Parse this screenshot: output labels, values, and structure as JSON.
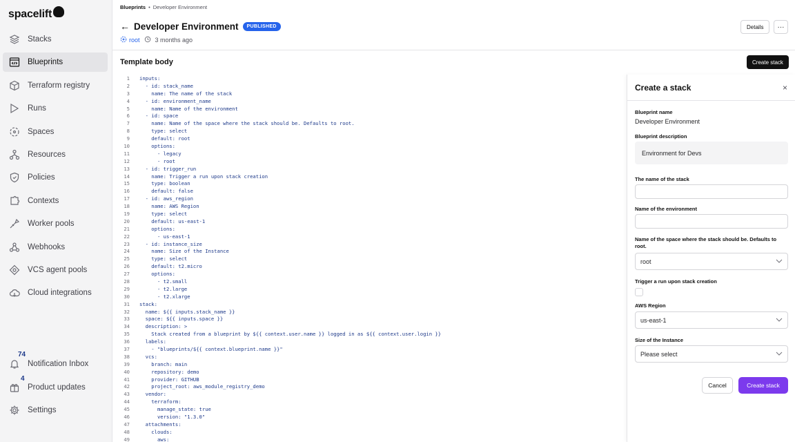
{
  "app": {
    "logo_text": "spacelift"
  },
  "sidebar": {
    "items": [
      {
        "label": "Stacks",
        "icon": "stacks-icon"
      },
      {
        "label": "Blueprints",
        "icon": "blueprints-icon"
      },
      {
        "label": "Terraform registry",
        "icon": "registry-icon"
      },
      {
        "label": "Runs",
        "icon": "runs-icon"
      },
      {
        "label": "Spaces",
        "icon": "spaces-icon"
      },
      {
        "label": "Resources",
        "icon": "resources-icon"
      },
      {
        "label": "Policies",
        "icon": "policies-icon"
      },
      {
        "label": "Contexts",
        "icon": "contexts-icon"
      },
      {
        "label": "Worker pools",
        "icon": "worker-pools-icon"
      },
      {
        "label": "Webhooks",
        "icon": "webhooks-icon"
      },
      {
        "label": "VCS agent pools",
        "icon": "vcs-agent-pools-icon"
      },
      {
        "label": "Cloud integrations",
        "icon": "cloud-integrations-icon"
      }
    ],
    "bottom": {
      "notifications": {
        "label": "Notification Inbox",
        "count": "74"
      },
      "updates": {
        "label": "Product updates",
        "count": "4"
      },
      "settings": {
        "label": "Settings"
      }
    }
  },
  "header": {
    "breadcrumb": {
      "parent": "Blueprints",
      "separator": "•",
      "current": "Developer Environment"
    },
    "title": "Developer Environment",
    "status": "PUBLISHED",
    "space": "root",
    "updated": "3 months ago",
    "details_label": "Details",
    "more_label": "···"
  },
  "template": {
    "section_title": "Template body",
    "create_button": "Create stack",
    "lines": [
      "inputs:",
      "  - id: stack_name",
      "    name: The name of the stack",
      "  - id: environment_name",
      "    name: Name of the environment",
      "  - id: space",
      "    name: Name of the space where the stack should be. Defaults to root.",
      "    type: select",
      "    default: root",
      "    options:",
      "      - legacy",
      "      - root",
      "  - id: trigger_run",
      "    name: Trigger a run upon stack creation",
      "    type: boolean",
      "    default: false",
      "  - id: aws_region",
      "    name: AWS Region",
      "    type: select",
      "    default: us-east-1",
      "    options:",
      "      - us-east-1",
      "  - id: instance_size",
      "    name: Size of the Instance",
      "    type: select",
      "    default: t2.micro",
      "    options:",
      "      - t2.small",
      "      - t2.large",
      "      - t2.xlarge",
      "stack:",
      "  name: ${{ inputs.stack_name }}",
      "  space: ${{ inputs.space }}",
      "  description: >",
      "    Stack created from a blueprint by ${{ context.user.name }} logged in as ${{ context.user.login }}",
      "  labels:",
      "    - \"blueprints/${{ context.blueprint.name }}\"",
      "  vcs:",
      "    branch: main",
      "    repository: demo",
      "    provider: GITHUB",
      "    project_root: aws_module_registry_demo",
      "  vendor:",
      "    terraform:",
      "      manage_state: true",
      "      version: \"1.3.0\"",
      "  attachments:",
      "    clouds:",
      "      aws:"
    ]
  },
  "drawer": {
    "title": "Create a stack",
    "close_label": "×",
    "blueprint_name_label": "Blueprint name",
    "blueprint_name_value": "Developer Environment",
    "blueprint_description_label": "Blueprint description",
    "blueprint_description_value": "Environment for Devs",
    "fields": {
      "stack_name_label": "The name of the stack",
      "stack_name_value": "",
      "environment_label": "Name of the environment",
      "environment_value": "",
      "space_label": "Name of the space where the stack should be. Defaults to root.",
      "space_value": "root",
      "trigger_label": "Trigger a run upon stack creation",
      "trigger_checked": false,
      "region_label": "AWS Region",
      "region_value": "us-east-1",
      "instance_label": "Size of the Instance",
      "instance_value": "Please select"
    },
    "cancel_label": "Cancel",
    "submit_label": "Create stack"
  },
  "colors": {
    "accent": "#7c3aed",
    "badge": "#2563eb",
    "dark_button": "#111111",
    "code_text": "#1e3a8a"
  }
}
